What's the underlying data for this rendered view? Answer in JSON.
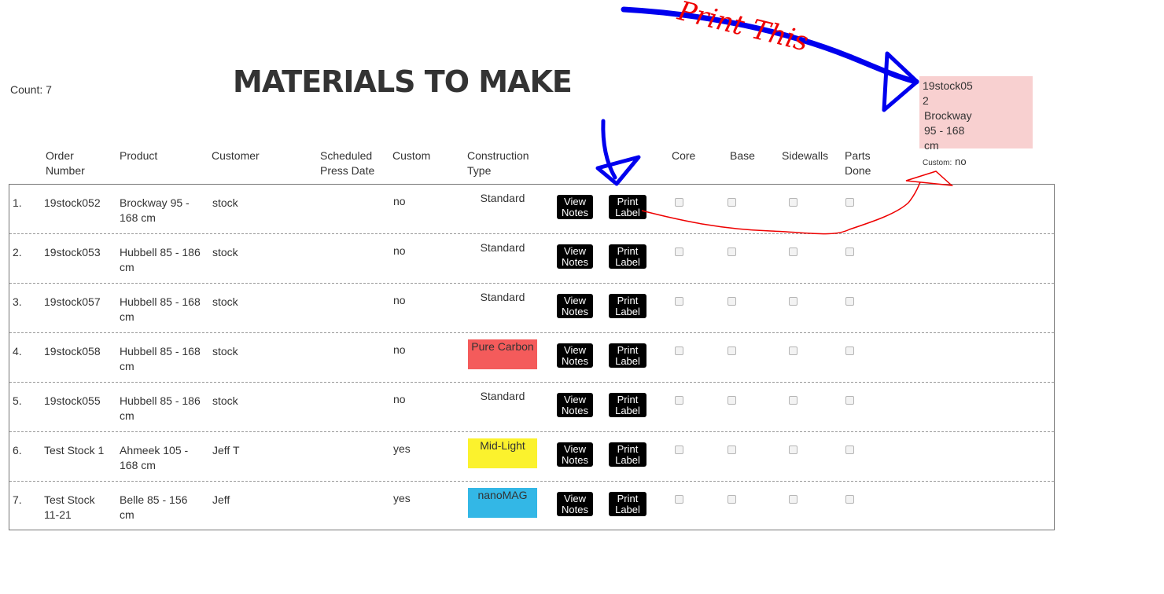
{
  "count_label": "Count: 7",
  "title": "MATERIALS TO MAKE",
  "headers": {
    "order": "Order Number",
    "product": "Product",
    "customer": "Customer",
    "press_date": "Scheduled Press Date",
    "custom": "Custom",
    "construction": "Construction Type",
    "core": "Core",
    "base": "Base",
    "sidewalls": "Sidewalls",
    "parts_done": "Parts Done"
  },
  "buttons": {
    "view_notes": "View Notes",
    "print_label": "Print Label"
  },
  "rows": [
    {
      "num": "1.",
      "order": "19stock052",
      "product": "Brockway 95 - 168 cm",
      "customer": "stock",
      "press_date": "",
      "custom": "no",
      "construction": "Standard",
      "construction_color": "#ffffff"
    },
    {
      "num": "2.",
      "order": "19stock053",
      "product": "Hubbell 85 - 186 cm",
      "customer": "stock",
      "press_date": "",
      "custom": "no",
      "construction": "Standard",
      "construction_color": "#ffffff"
    },
    {
      "num": "3.",
      "order": "19stock057",
      "product": "Hubbell 85 - 168 cm",
      "customer": "stock",
      "press_date": "",
      "custom": "no",
      "construction": "Standard",
      "construction_color": "#ffffff"
    },
    {
      "num": "4.",
      "order": "19stock058",
      "product": "Hubbell 85 - 168 cm",
      "customer": "stock",
      "press_date": "",
      "custom": "no",
      "construction": "Pure Carbon",
      "construction_color": "#f45b5b"
    },
    {
      "num": "5.",
      "order": "19stock055",
      "product": "Hubbell 85 - 186 cm",
      "customer": "stock",
      "press_date": "",
      "custom": "no",
      "construction": "Standard",
      "construction_color": "#ffffff"
    },
    {
      "num": "6.",
      "order": "Test Stock 1",
      "product": "Ahmeek 105 - 168 cm",
      "customer": "Jeff T",
      "press_date": "",
      "custom": "yes",
      "construction": "Mid-Light",
      "construction_color": "#fbf22d"
    },
    {
      "num": "7.",
      "order": "Test Stock 11-21",
      "product": "Belle 85 - 156 cm",
      "customer": "Jeff",
      "press_date": "",
      "custom": "yes",
      "construction": "nanoMAG",
      "construction_color": "#33b7e6"
    }
  ],
  "label_preview": {
    "lines": [
      "19stock05",
      "2",
      "Brockway",
      "95 - 168",
      "cm"
    ],
    "custom_label": "Custom:",
    "custom_value": "no",
    "background": "#f8d0d0"
  },
  "annotation": {
    "text": "Print This",
    "blue": "#0000ee",
    "red": "#ee0000"
  }
}
